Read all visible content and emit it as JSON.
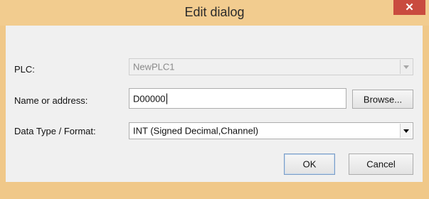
{
  "window": {
    "title": "Edit dialog",
    "close_symbol": "✕"
  },
  "form": {
    "plc": {
      "label": "PLC:",
      "value": "NewPLC1"
    },
    "name": {
      "label": "Name or address:",
      "value": "D00000"
    },
    "data_type": {
      "label": "Data Type / Format:",
      "value": "INT (Signed Decimal,Channel)"
    }
  },
  "buttons": {
    "browse": "Browse...",
    "ok": "OK",
    "cancel": "Cancel"
  },
  "colors": {
    "frame": "#f0c889",
    "close": "#c94b3f",
    "client": "#f0f0f0"
  },
  "icons": {
    "close": "close-icon",
    "dropdown": "chevron-down-icon"
  }
}
